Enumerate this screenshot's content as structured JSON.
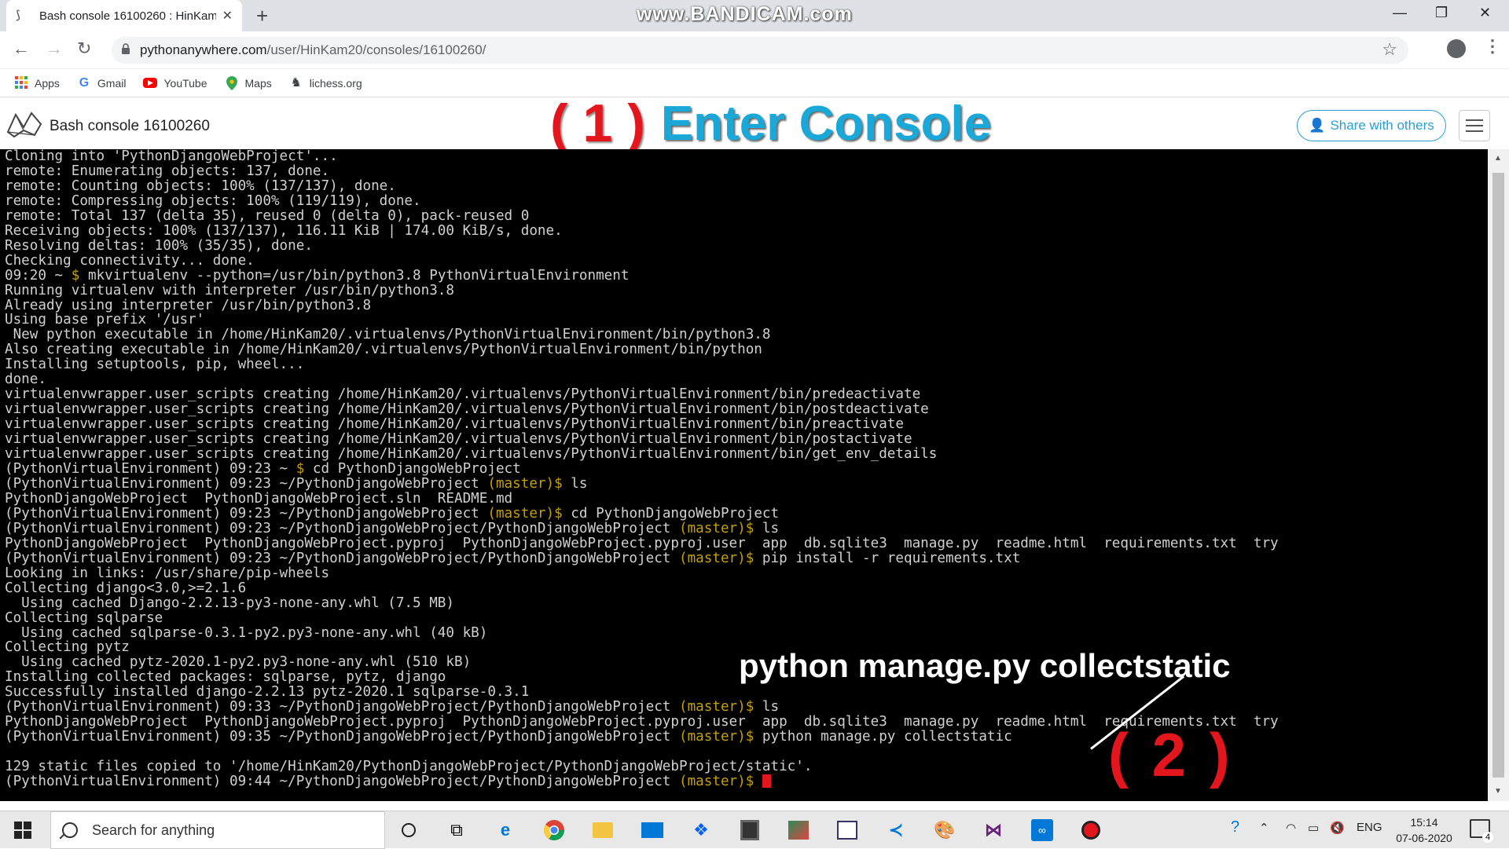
{
  "browser": {
    "tab_title": "Bash console 16100260 : HinKam",
    "tab_close": "✕",
    "new_tab": "+",
    "watermark": "www.BANDICAM.com",
    "url_host": "pythonanywhere.com",
    "url_path": "/user/HinKam20/consoles/16100260/",
    "bookmarks": [
      {
        "label": "Apps",
        "icon": "apps-grid-icon"
      },
      {
        "label": "Gmail",
        "icon": "google-icon"
      },
      {
        "label": "YouTube",
        "icon": "youtube-icon"
      },
      {
        "label": "Maps",
        "icon": "maps-pin-icon"
      },
      {
        "label": "lichess.org",
        "icon": "lichess-icon"
      }
    ]
  },
  "header": {
    "console_title": "Bash console 16100260",
    "annotation_number": "( 1 )",
    "annotation_text": "Enter Console",
    "share_label": "Share with others"
  },
  "terminal": {
    "lines": [
      {
        "t": "Cloning into 'PythonDjangoWebProject'..."
      },
      {
        "t": "remote: Enumerating objects: 137, done."
      },
      {
        "t": "remote: Counting objects: 100% (137/137), done."
      },
      {
        "t": "remote: Compressing objects: 100% (119/119), done."
      },
      {
        "t": "remote: Total 137 (delta 35), reused 0 (delta 0), pack-reused 0"
      },
      {
        "t": "Receiving objects: 100% (137/137), 116.11 KiB | 174.00 KiB/s, done."
      },
      {
        "t": "Resolving deltas: 100% (35/35), done."
      },
      {
        "t": "Checking connectivity... done."
      },
      {
        "p": "09:20 ~ ",
        "d": "$ ",
        "t": "mkvirtualenv --python=/usr/bin/python3.8 PythonVirtualEnvironment"
      },
      {
        "t": "Running virtualenv with interpreter /usr/bin/python3.8"
      },
      {
        "t": "Already using interpreter /usr/bin/python3.8"
      },
      {
        "t": "Using base prefix '/usr'"
      },
      {
        "t": " New python executable in /home/HinKam20/.virtualenvs/PythonVirtualEnvironment/bin/python3.8"
      },
      {
        "t": "Also creating executable in /home/HinKam20/.virtualenvs/PythonVirtualEnvironment/bin/python"
      },
      {
        "t": "Installing setuptools, pip, wheel..."
      },
      {
        "t": "done."
      },
      {
        "t": "virtualenvwrapper.user_scripts creating /home/HinKam20/.virtualenvs/PythonVirtualEnvironment/bin/predeactivate"
      },
      {
        "t": "virtualenvwrapper.user_scripts creating /home/HinKam20/.virtualenvs/PythonVirtualEnvironment/bin/postdeactivate"
      },
      {
        "t": "virtualenvwrapper.user_scripts creating /home/HinKam20/.virtualenvs/PythonVirtualEnvironment/bin/preactivate"
      },
      {
        "t": "virtualenvwrapper.user_scripts creating /home/HinKam20/.virtualenvs/PythonVirtualEnvironment/bin/postactivate"
      },
      {
        "t": "virtualenvwrapper.user_scripts creating /home/HinKam20/.virtualenvs/PythonVirtualEnvironment/bin/get_env_details"
      },
      {
        "p": "(PythonVirtualEnvironment) 09:23 ~ ",
        "d": "$ ",
        "t": "cd PythonDjangoWebProject"
      },
      {
        "p": "(PythonVirtualEnvironment) 09:23 ~/PythonDjangoWebProject ",
        "b": "(master)",
        "d": "$ ",
        "t": "ls"
      },
      {
        "t": "PythonDjangoWebProject  PythonDjangoWebProject.sln  README.md"
      },
      {
        "p": "(PythonVirtualEnvironment) 09:23 ~/PythonDjangoWebProject ",
        "b": "(master)",
        "d": "$ ",
        "t": "cd PythonDjangoWebProject"
      },
      {
        "p": "(PythonVirtualEnvironment) 09:23 ~/PythonDjangoWebProject/PythonDjangoWebProject ",
        "b": "(master)",
        "d": "$ ",
        "t": "ls"
      },
      {
        "t": "PythonDjangoWebProject  PythonDjangoWebProject.pyproj  PythonDjangoWebProject.pyproj.user  app  db.sqlite3  manage.py  readme.html  requirements.txt  try"
      },
      {
        "p": "(PythonVirtualEnvironment) 09:23 ~/PythonDjangoWebProject/PythonDjangoWebProject ",
        "b": "(master)",
        "d": "$ ",
        "t": "pip install -r requirements.txt"
      },
      {
        "t": "Looking in links: /usr/share/pip-wheels"
      },
      {
        "t": "Collecting django<3.0,>=2.1.6"
      },
      {
        "t": "  Using cached Django-2.2.13-py3-none-any.whl (7.5 MB)"
      },
      {
        "t": "Collecting sqlparse"
      },
      {
        "t": "  Using cached sqlparse-0.3.1-py2.py3-none-any.whl (40 kB)"
      },
      {
        "t": "Collecting pytz"
      },
      {
        "t": "  Using cached pytz-2020.1-py2.py3-none-any.whl (510 kB)"
      },
      {
        "t": "Installing collected packages: sqlparse, pytz, django"
      },
      {
        "t": "Successfully installed django-2.2.13 pytz-2020.1 sqlparse-0.3.1"
      },
      {
        "p": "(PythonVirtualEnvironment) 09:33 ~/PythonDjangoWebProject/PythonDjangoWebProject ",
        "b": "(master)",
        "d": "$ ",
        "t": "ls"
      },
      {
        "t": "PythonDjangoWebProject  PythonDjangoWebProject.pyproj  PythonDjangoWebProject.pyproj.user  app  db.sqlite3  manage.py  readme.html  requirements.txt  try"
      },
      {
        "p": "(PythonVirtualEnvironment) 09:35 ~/PythonDjangoWebProject/PythonDjangoWebProject ",
        "b": "(master)",
        "d": "$ ",
        "t": "python manage.py collectstatic"
      },
      {
        "t": ""
      },
      {
        "t": "129 static files copied to '/home/HinKam20/PythonDjangoWebProject/PythonDjangoWebProject/static'."
      },
      {
        "p": "(PythonVirtualEnvironment) 09:44 ~/PythonDjangoWebProject/PythonDjangoWebProject ",
        "b": "(master)",
        "d": "$ ",
        "t": "",
        "cursor": true
      }
    ],
    "annotation_command": "python manage.py collectstatic",
    "annotation_number": "( 2 )"
  },
  "taskbar": {
    "search_placeholder": "Search for anything",
    "language": "ENG",
    "time": "15:14",
    "date": "07-06-2020",
    "notification_count": "4",
    "apps": [
      "task-view-icon",
      "edge-icon",
      "chrome-icon",
      "file-explorer-icon",
      "mail-icon",
      "dropbox-icon",
      "calculator-icon",
      "photos-icon",
      "snipping-icon",
      "vscode-icon",
      "paint-icon",
      "visual-studio-icon",
      "bandicam-icon",
      "record-icon"
    ]
  },
  "colors": {
    "accent": "#2a9fd6",
    "annotation_red": "#e3161d",
    "annotation_blue": "#1aa8d8",
    "terminal_bg": "#000000",
    "prompt_dollar": "#c4a000",
    "branch": "#c4a000"
  }
}
